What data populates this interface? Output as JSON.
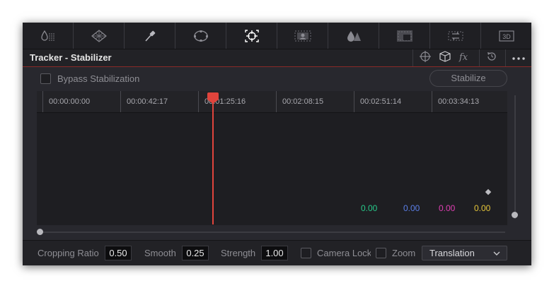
{
  "toolbar": {
    "tools": [
      {
        "icon": "qualifier-icon"
      },
      {
        "icon": "power-windows-icon"
      },
      {
        "icon": "eyedropper-icon"
      },
      {
        "icon": "window-circle-icon"
      },
      {
        "icon": "tracker-icon",
        "active": true
      },
      {
        "icon": "magic-mask-icon"
      },
      {
        "icon": "blur-icon"
      },
      {
        "icon": "key-icon"
      },
      {
        "icon": "sizing-icon"
      },
      {
        "icon": "3d-icon",
        "label": "3D"
      }
    ]
  },
  "header": {
    "title": "Tracker - Stabilizer",
    "icons": [
      "crosshair-icon",
      "cube-icon",
      "fx-icon",
      "reset-icon",
      "more-options-icon"
    ]
  },
  "options": {
    "bypass_label": "Bypass Stabilization",
    "bypass_checked": false,
    "stabilize_label": "Stabilize"
  },
  "timeline": {
    "timecodes": [
      "00:00:00:00",
      "00:00:42:17",
      "00:01:25:16",
      "00:02:08:15",
      "00:02:51:14",
      "00:03:34:13"
    ],
    "values": [
      {
        "text": "0.00",
        "color": "#27c98a"
      },
      {
        "text": "0.00",
        "color": "#5b7fe8"
      },
      {
        "text": "0.00",
        "color": "#e03fb3"
      },
      {
        "text": "0.00",
        "color": "#e6c63a"
      }
    ],
    "playhead_color": "#e0443c"
  },
  "bottom": {
    "cropping_ratio_label": "Cropping Ratio",
    "cropping_ratio_value": "0.50",
    "smooth_label": "Smooth",
    "smooth_value": "0.25",
    "strength_label": "Strength",
    "strength_value": "1.00",
    "camera_lock_label": "Camera Lock",
    "camera_lock_checked": false,
    "zoom_label": "Zoom",
    "zoom_checked": false,
    "mode_value": "Translation"
  }
}
